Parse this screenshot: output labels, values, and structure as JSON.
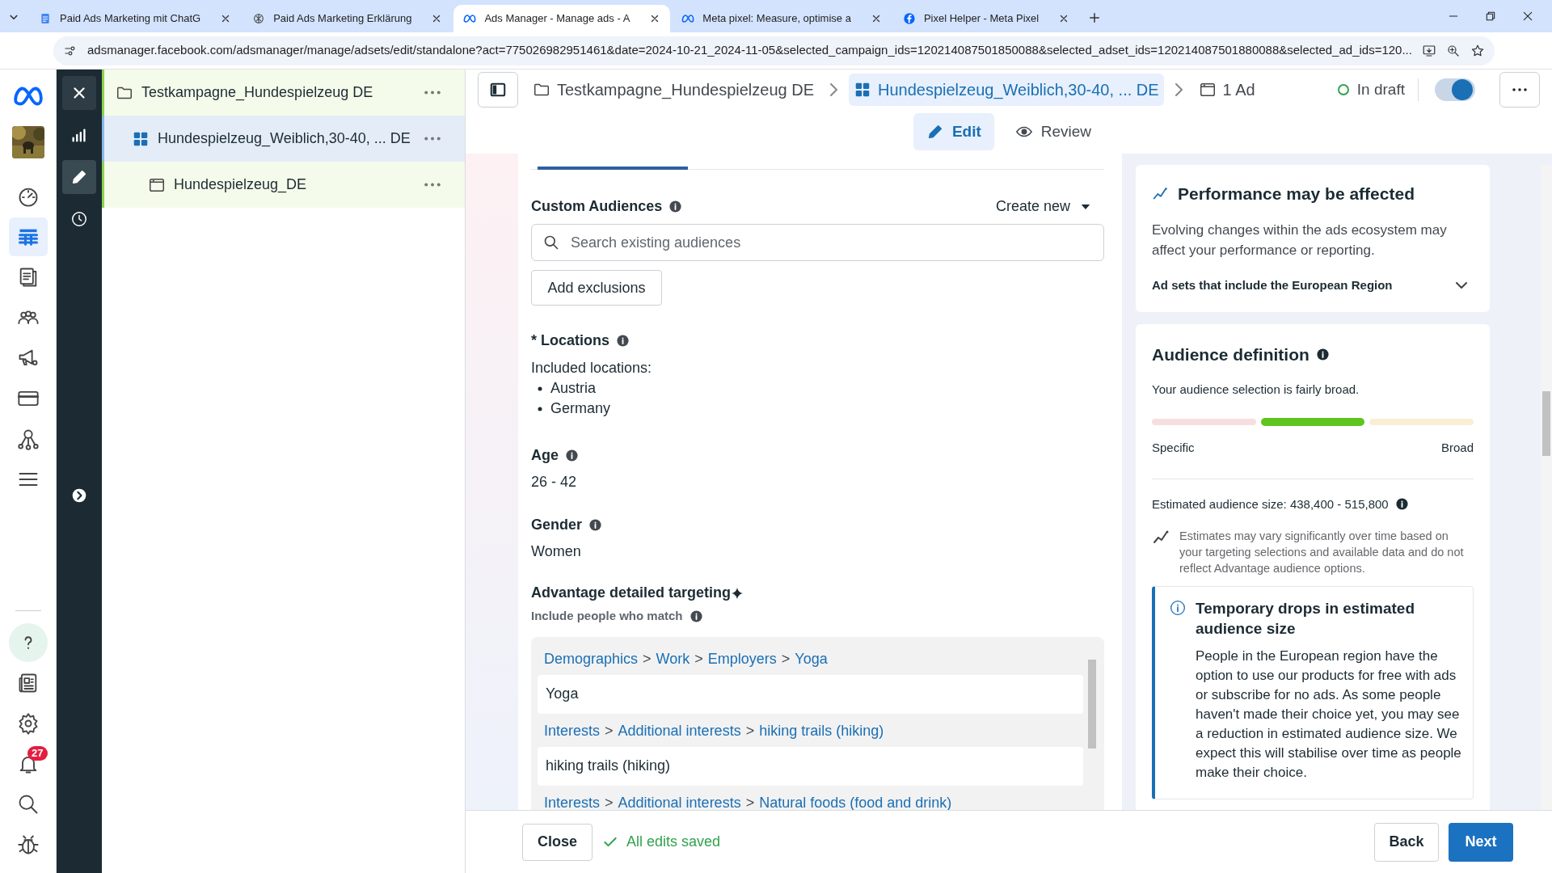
{
  "browser": {
    "tabs": [
      {
        "title": "Paid Ads Marketing mit ChatG",
        "kind": "doc",
        "selected": false
      },
      {
        "title": "Paid Ads Marketing Erklärung",
        "kind": "ai",
        "selected": false
      },
      {
        "title": "Ads Manager - Manage ads - A",
        "kind": "meta",
        "selected": true
      },
      {
        "title": "Meta pixel: Measure, optimise a",
        "kind": "meta",
        "selected": false
      },
      {
        "title": "Pixel Helper - Meta Pixel",
        "kind": "fb",
        "selected": false
      }
    ],
    "url": "adsmanager.facebook.com/adsmanager/manage/adsets/edit/standalone?act=775026982951461&date=2024-10-21_2024-11-05&selected_campaign_ids=120214087501850088&selected_adset_ids=120214087501880088&selected_ad_ids=120..."
  },
  "rail": {
    "top": [
      {
        "kind": "gauge",
        "selected": false
      },
      {
        "kind": "table",
        "selected": true
      },
      {
        "kind": "pages",
        "selected": false
      },
      {
        "kind": "people",
        "selected": false
      },
      {
        "kind": "megaphone",
        "selected": false
      },
      {
        "kind": "card",
        "selected": false
      },
      {
        "kind": "network",
        "selected": false
      },
      {
        "kind": "menu",
        "selected": false
      }
    ],
    "bottom": [
      {
        "kind": "help",
        "selected": false
      },
      {
        "kind": "news",
        "selected": false
      },
      {
        "kind": "gear",
        "selected": false
      },
      {
        "kind": "bell",
        "selected": false,
        "badge": "27"
      },
      {
        "kind": "search",
        "selected": false
      },
      {
        "kind": "bug",
        "selected": false
      }
    ]
  },
  "tools": [
    {
      "kind": "close",
      "selected": false
    },
    {
      "kind": "chart",
      "selected": false
    },
    {
      "kind": "pencil",
      "selected": true
    },
    {
      "kind": "clock",
      "selected": false
    },
    {
      "kind": "expand",
      "selected": false
    }
  ],
  "tree": [
    {
      "label": "Testkampagne_Hundespielzeug DE",
      "kind": "campaign",
      "selected": false,
      "children": [
        {
          "label": "Hundespielzeug_Weiblich,30-40, ... DE",
          "kind": "adset",
          "selected": true,
          "children": [
            {
              "label": "Hundespielzeug_DE",
              "kind": "ad",
              "selected": false
            }
          ]
        }
      ]
    }
  ],
  "breadcrumbs": [
    {
      "label": "Testkampagne_Hundespielzeug DE",
      "kind": "campaign",
      "selected": false
    },
    {
      "label": "Hundespielzeug_Weiblich,30-40, ... DE",
      "kind": "adset",
      "selected": true
    },
    {
      "label": "1 Ad",
      "kind": "ad",
      "selected": false
    }
  ],
  "status": {
    "label": "In draft",
    "on": true
  },
  "modes": [
    {
      "label": "Edit",
      "kind": "edit",
      "selected": true
    },
    {
      "label": "Review",
      "kind": "review",
      "selected": false
    }
  ],
  "form": {
    "custom_audiences": {
      "label": "Custom Audiences",
      "action": "Create new",
      "placeholder": "Search existing audiences",
      "button": "Add exclusions"
    },
    "locations": {
      "label": "* Locations",
      "included": "Included locations:",
      "items": [
        "Austria",
        "Germany"
      ]
    },
    "age": {
      "label": "Age",
      "value": "26 - 42"
    },
    "gender": {
      "label": "Gender",
      "value": "Women"
    },
    "targeting": {
      "label": "Advantage detailed targeting",
      "hint": "Include people who match",
      "separator": ">",
      "entries": [
        {
          "path": [
            "Demographics",
            "Work",
            "Employers",
            "Yoga"
          ],
          "value": "Yoga"
        },
        {
          "path": [
            "Interests",
            "Additional interests",
            "hiking trails (hiking)"
          ],
          "value": "hiking trails (hiking)"
        },
        {
          "path": [
            "Interests",
            "Additional interests",
            "Natural foods (food and drink)"
          ]
        }
      ]
    }
  },
  "side": {
    "performance": {
      "title": "Performance may be affected",
      "body": "Evolving changes within the ads ecosystem may affect your performance or reporting.",
      "expander": "Ad sets that include the European Region",
      "expanded": false
    },
    "audience": {
      "title": "Audience definition",
      "summary": "Your audience selection is fairly broad.",
      "segments": [
        {
          "color": "#f9dede",
          "selected": false
        },
        {
          "color": "#5fc41f",
          "selected": true
        },
        {
          "color": "#fbefd2",
          "selected": false
        }
      ],
      "low": "Specific",
      "high": "Broad",
      "estimate": "Estimated audience size: 438,400 - 515,800",
      "note": "Estimates may vary significantly over time based on your targeting selections and available data and do not reflect Advantage audience options.",
      "notice": {
        "title": "Temporary drops in estimated audience size",
        "body": "People in the European region have the option to use our products for free with ads or subscribe for no ads. As some people haven't made their choice yet, you may see a reduction in estimated audience size. We expect this will stabilise over time as people make their choice."
      }
    }
  },
  "footer": {
    "close": "Close",
    "saved": "All edits saved",
    "back": "Back",
    "next": "Next"
  }
}
